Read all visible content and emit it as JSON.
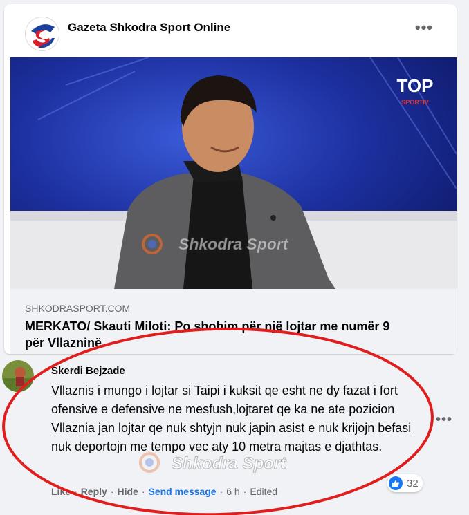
{
  "post": {
    "page_name": "Gazeta Shkodra Sport Online",
    "more_icon": "ellipsis-icon",
    "media": {
      "broadcaster_logo": "TOP",
      "broadcaster_sub": "SPORTIV",
      "watermark": "Shkodra Sport"
    },
    "link": {
      "domain": "SHKODRASPORT.COM",
      "headline": "MERKATO/ Skauti Miloti: Po shohim për një lojtar me numër 9 për Vllazninë"
    }
  },
  "comment": {
    "author": "Skerdi Bejzade",
    "text": "Vllaznis i mungo i lojtar si Taipi i kuksit qe esht ne dy fazat i fort ofensive e defensive ne mesfush,lojtaret qe ka ne ate pozicion Vllaznia jan lojtar qe nuk shtyjn nuk japin asist e nuk krijojn befasi nuk deportojn me tempo vec aty 10 metra majtas e djathtas.",
    "watermark": "Shkodra Sport",
    "reaction_count": "32",
    "actions": {
      "like": "Like",
      "reply": "Reply",
      "hide": "Hide",
      "send_message": "Send message",
      "time": "6 h",
      "edited": "Edited"
    }
  },
  "colors": {
    "accent": "#1877f2",
    "annotation": "#e01e1e",
    "background": "#f0f2f5"
  }
}
